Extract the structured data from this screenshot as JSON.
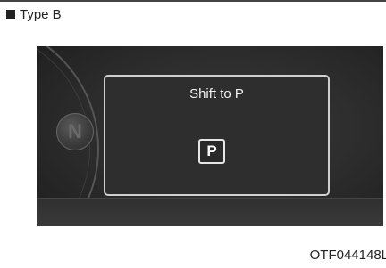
{
  "heading": {
    "label": "Type B"
  },
  "cluster": {
    "gear_indicator": "N",
    "popup": {
      "message": "Shift to P",
      "gear": "P"
    }
  },
  "figure_code": "OTF044148L",
  "colors": {
    "cluster_bg": "#2a2a2a",
    "popup_border": "#cfcfcf",
    "text_light": "#f2f2f2"
  }
}
